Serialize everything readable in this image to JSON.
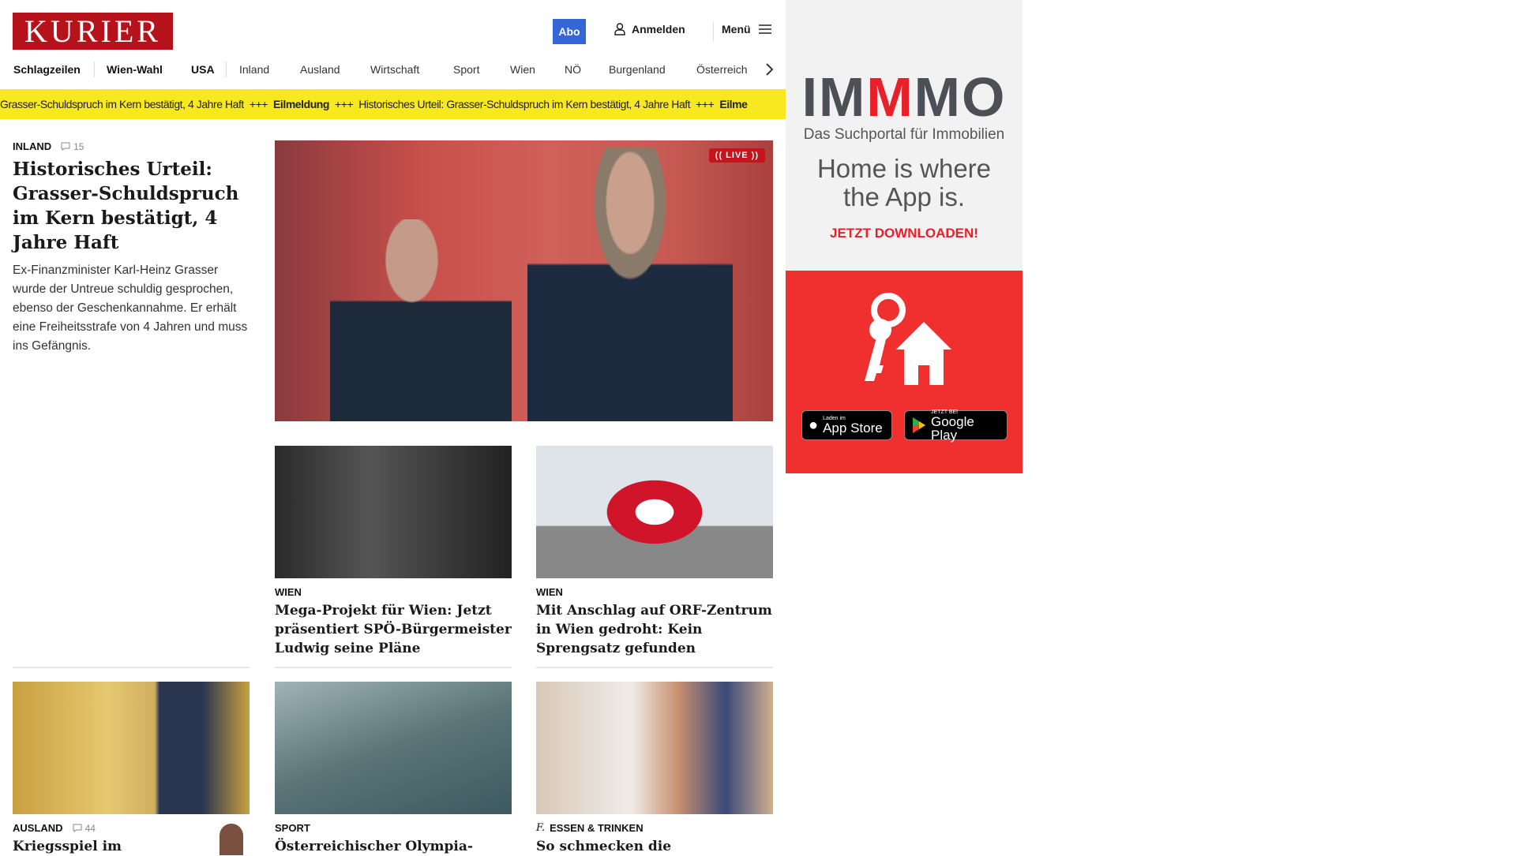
{
  "header": {
    "logo": "KURIER",
    "abo": "Abo",
    "login": "Anmelden",
    "menu": "Menü"
  },
  "nav": [
    "Schlagzeilen",
    "Wien-Wahl",
    "USA",
    "Inland",
    "Ausland",
    "Wirtschaft",
    "Sport",
    "Wien",
    "NÖ",
    "Burgenland",
    "Österreich"
  ],
  "ticker": {
    "headline_tail": "Grasser-Schuldspruch im Kern bestätigt, 4 Jahre Haft",
    "sep": "+++",
    "label": "Eilmeldung",
    "headline": "Historisches Urteil: Grasser-Schuldspruch im Kern bestätigt, 4 Jahre Haft",
    "label_cut": "Eilme"
  },
  "lead": {
    "category": "INLAND",
    "comments": "15",
    "title": "Historisches Urteil: Grasser-Schuldspruch im Kern bestätigt, 4 Jahre Haft",
    "teaser": "Ex-Finanzminister Karl-Heinz Grasser wurde der Untreue schuldig gesprochen, ebenso der Geschenkannahme. Er erhält eine Freiheitsstrafe von 4 Jahren und muss ins Gefängnis.",
    "badge": "(( LIVE ))"
  },
  "articles": [
    {
      "category": "WIEN",
      "title": "Mega-Projekt für Wien: Jetzt präsentiert SPÖ-Bürgermeister Ludwig seine Pläne"
    },
    {
      "category": "WIEN",
      "title": "Mit Anschlag auf ORF-Zentrum in Wien gedroht: Kein Sprengsatz gefunden"
    },
    {
      "category": "AUSLAND",
      "comments": "44",
      "title": "Kriegsspiel im"
    },
    {
      "category": "SPORT",
      "title": "Österreichischer Olympia-"
    },
    {
      "category": "ESSEN & TRINKEN",
      "title": "So schmecken die"
    }
  ],
  "ad": {
    "brand_a": "IM",
    "brand_b": "M",
    "brand_c": "MO",
    "tagline": "Das Suchportal für Immobilien",
    "slogan1": "Home is where",
    "slogan2": "the App is.",
    "cta": "JETZT DOWNLOADEN!",
    "appstore_small": "Laden im",
    "appstore": "App Store",
    "gplay_small": "JETZT BEI",
    "gplay": "Google Play"
  }
}
